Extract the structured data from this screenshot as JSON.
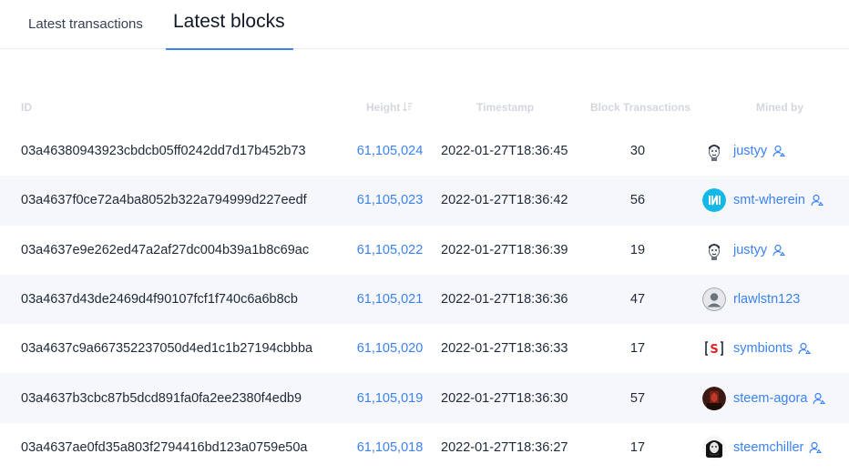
{
  "tabs": {
    "transactions_label": "Latest transactions",
    "blocks_label": "Latest blocks"
  },
  "table": {
    "headers": {
      "id": "ID",
      "height": "Height",
      "timestamp": "Timestamp",
      "block_transactions": "Block Transactions",
      "mined_by": "Mined by"
    },
    "rows": [
      {
        "id": "03a46380943923cbdcb05ff0242dd7d17b452b73",
        "height": "61,105,024",
        "timestamp": "2022-01-27T18:36:45",
        "tx_count": "30",
        "miner": "justyy",
        "avatar": "cartoon-face",
        "has_user_icon": true
      },
      {
        "id": "03a4637f0ce72a4ba8052b322a794999d227eedf",
        "height": "61,105,023",
        "timestamp": "2022-01-27T18:36:42",
        "tx_count": "56",
        "miner": "smt-wherein",
        "avatar": "cyan-logo",
        "has_user_icon": true
      },
      {
        "id": "03a4637e9e262ed47a2af27dc004b39a1b8c69ac",
        "height": "61,105,022",
        "timestamp": "2022-01-27T18:36:39",
        "tx_count": "19",
        "miner": "justyy",
        "avatar": "cartoon-face",
        "has_user_icon": true
      },
      {
        "id": "03a4637d43de2469d4f90107fcf1f740c6a6b8cb",
        "height": "61,105,021",
        "timestamp": "2022-01-27T18:36:36",
        "tx_count": "47",
        "miner": "rlawlstn123",
        "avatar": "default-user",
        "has_user_icon": false
      },
      {
        "id": "03a4637c9a667352237050d4ed1c1b27194cbbba",
        "height": "61,105,020",
        "timestamp": "2022-01-27T18:36:33",
        "tx_count": "17",
        "miner": "symbionts",
        "avatar": "red-s-logo",
        "has_user_icon": true
      },
      {
        "id": "03a4637b3cbc87b5dcd891fa0fa2ee2380f4edb9",
        "height": "61,105,019",
        "timestamp": "2022-01-27T18:36:30",
        "tx_count": "57",
        "miner": "steem-agora",
        "avatar": "dark-red-photo",
        "has_user_icon": true
      },
      {
        "id": "03a4637ae0fd35a803f2794416bd123a0759e50a",
        "height": "61,105,018",
        "timestamp": "2022-01-27T18:36:27",
        "tx_count": "17",
        "miner": "steemchiller",
        "avatar": "bw-portrait",
        "has_user_icon": true
      }
    ]
  },
  "colors": {
    "link": "#3b82f6",
    "header_text": "#d3d7dd",
    "row_alt_bg": "#f6f7fa",
    "tab_underline": "#3b82f6"
  }
}
